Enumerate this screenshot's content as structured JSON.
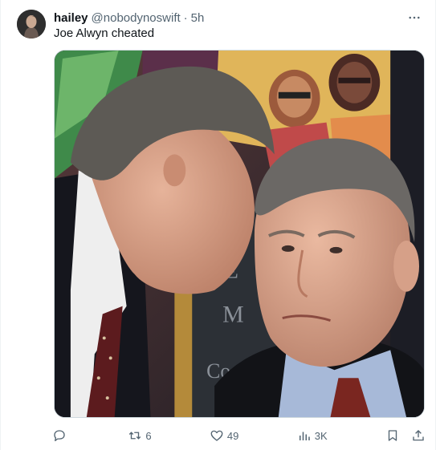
{
  "tweet": {
    "author_name": "hailey",
    "handle": "@nobodynoswift",
    "separator": "·",
    "time": "5h",
    "text": "Joe Alwyn cheated",
    "media": {
      "chalkboard_text": [
        "KE",
        "M",
        "Co"
      ]
    }
  },
  "actions": {
    "reply_count": "",
    "retweet_count": "6",
    "like_count": "49",
    "views_count": "3K"
  },
  "icons": {
    "more": "more-icon",
    "reply": "reply-icon",
    "retweet": "retweet-icon",
    "like": "heart-icon",
    "views": "views-icon",
    "bookmark": "bookmark-icon",
    "share": "share-icon"
  },
  "colors": {
    "text_primary": "#0f1419",
    "text_secondary": "#536471",
    "border": "#cfd9de"
  }
}
